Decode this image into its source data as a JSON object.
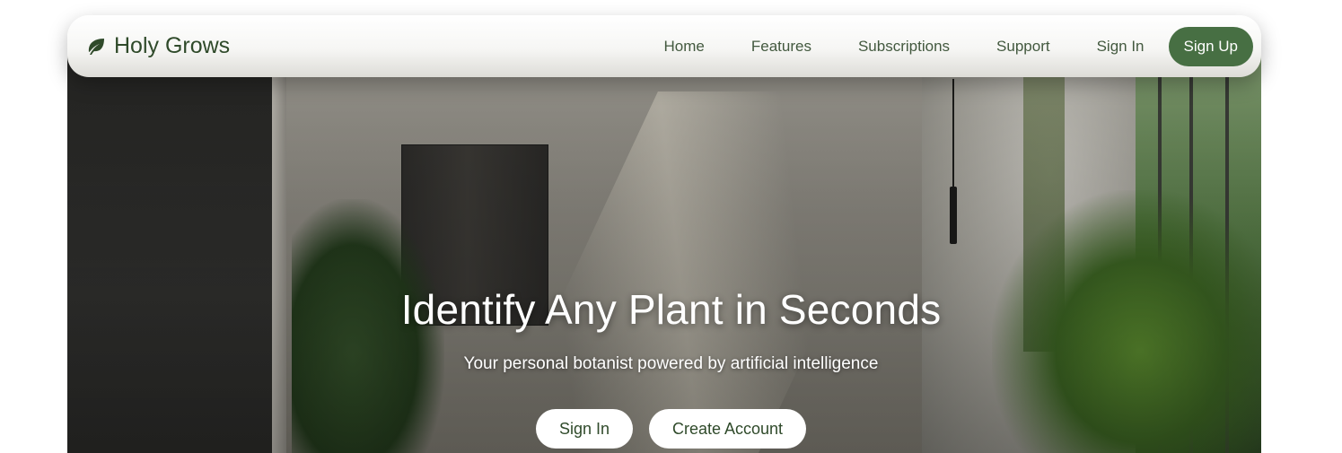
{
  "brand": {
    "name": "Holy Grows",
    "icon": "leaf-icon",
    "color": "#2f4a2a"
  },
  "nav": {
    "links": [
      "Home",
      "Features",
      "Subscriptions",
      "Support",
      "Sign In"
    ],
    "signup_label": "Sign Up",
    "accent": "#476f43"
  },
  "hero": {
    "title": "Identify Any Plant in Seconds",
    "subtitle": "Your personal botanist powered by artificial intelligence",
    "primary_button": "Sign In",
    "secondary_button": "Create Account"
  }
}
